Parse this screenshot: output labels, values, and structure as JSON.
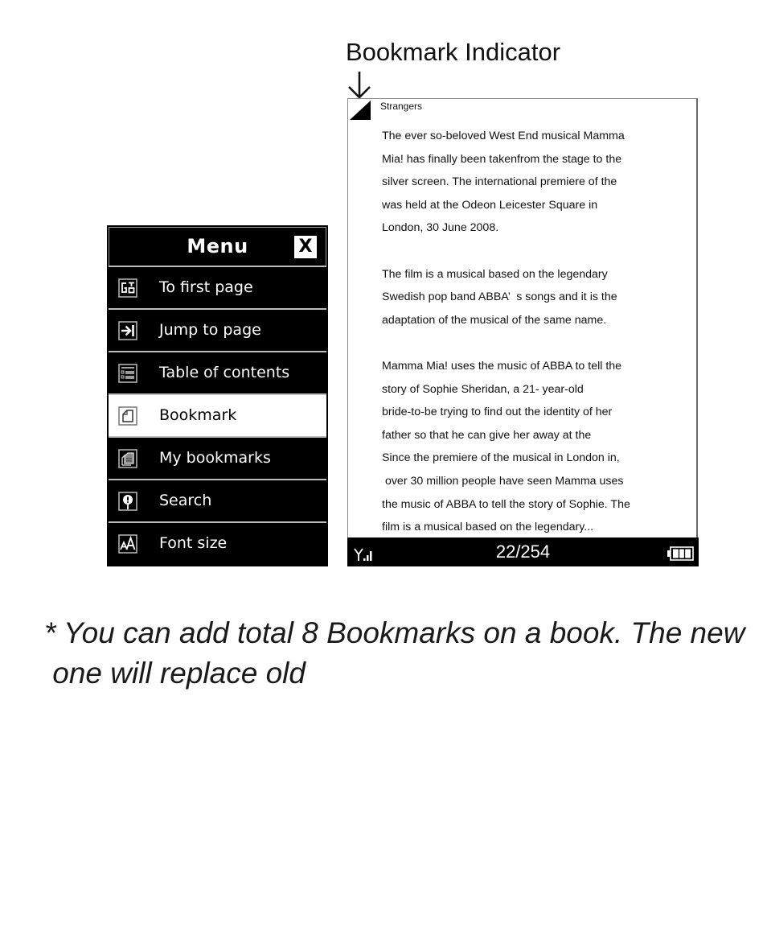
{
  "annotation": {
    "title": "Bookmark Indicator",
    "arrow_icon": "down-arrow-icon"
  },
  "menu": {
    "title": "Menu",
    "close_label": "X",
    "items": [
      {
        "label": "To first page",
        "icon": "goto-first-icon",
        "selected": false
      },
      {
        "label": "Jump to page",
        "icon": "jump-to-page-icon",
        "selected": false
      },
      {
        "label": "Table of contents",
        "icon": "table-of-contents-icon",
        "selected": false
      },
      {
        "label": "Bookmark",
        "icon": "bookmark-icon",
        "selected": true
      },
      {
        "label": "My bookmarks",
        "icon": "my-bookmarks-icon",
        "selected": false
      },
      {
        "label": "Search",
        "icon": "search-icon",
        "selected": false
      },
      {
        "label": "Font size",
        "icon": "font-size-icon",
        "selected": false
      }
    ]
  },
  "reader": {
    "book_title": "Strangers",
    "paragraphs": [
      [
        "The ever so-beloved West End musical Mamma",
        "Mia! has finally been takenfrom the stage to the",
        "silver screen. The international premiere of the",
        "was held at the Odeon Leicester Square in",
        "London, 30 June 2008."
      ],
      [
        "The film is a musical based on the legendary",
        "Swedish pop band ABBA’  s songs and it is the",
        "adaptation of the musical of the same name."
      ],
      [
        "Mamma Mia! uses the music of ABBA to tell the",
        "story of Sophie Sheridan, a 21- year-old",
        "bride-to-be trying to find out the identity of her",
        "father so that he can give her away at the",
        "Since the premiere of the musical in London in,",
        " over 30 million people have seen Mamma uses",
        "the music of ABBA to tell the story of Sophie. The",
        "film is a musical based on the legendary..."
      ]
    ],
    "status": {
      "page_current": 22,
      "page_total": 254,
      "page_label": "22/254",
      "signal_icon": "signal-strength-icon",
      "battery_icon": "battery-icon",
      "battery_level": 1.0
    }
  },
  "footnote": {
    "lines": [
      "* You can add total 8 Bookmarks on a book. The new",
      " one will replace old"
    ]
  }
}
